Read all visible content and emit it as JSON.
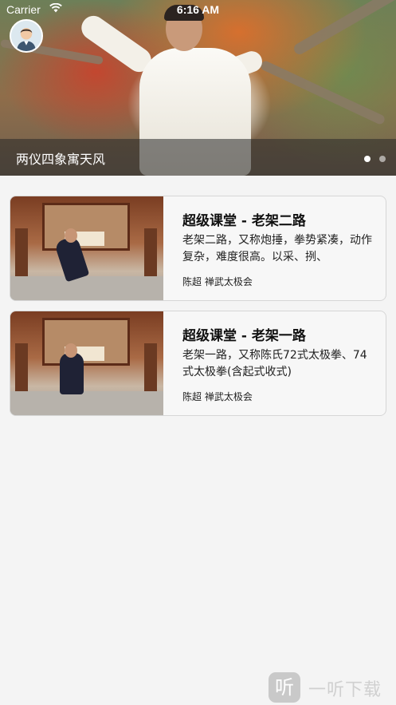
{
  "status_bar": {
    "carrier": "Carrier",
    "time": "6:16 AM",
    "wifi_icon": "wifi-icon"
  },
  "header": {
    "avatar_icon": "user-avatar-icon"
  },
  "banner": {
    "caption": "两仪四象寓天风",
    "pages_total": 2,
    "active_page": 1
  },
  "courses": [
    {
      "title": "超级课堂 - 老架二路",
      "description": "老架二路，又称炮捶，拳势紧凑，动作复杂，难度很高。以采、挒、",
      "meta": "陈超 禅武太极会"
    },
    {
      "title": "超级课堂 - 老架一路",
      "description": "老架一路，又称陈氏72式太极拳、74式太极拳(含起式收式)",
      "meta": "陈超 禅武太极会"
    }
  ],
  "watermark": {
    "icon_glyph": "听",
    "text": "一听下载"
  },
  "colors": {
    "background": "#f4f4f4",
    "card_background": "#f7f7f7",
    "card_border": "#d6d6d6",
    "caption_bar": "rgba(40,40,40,0.55)"
  }
}
